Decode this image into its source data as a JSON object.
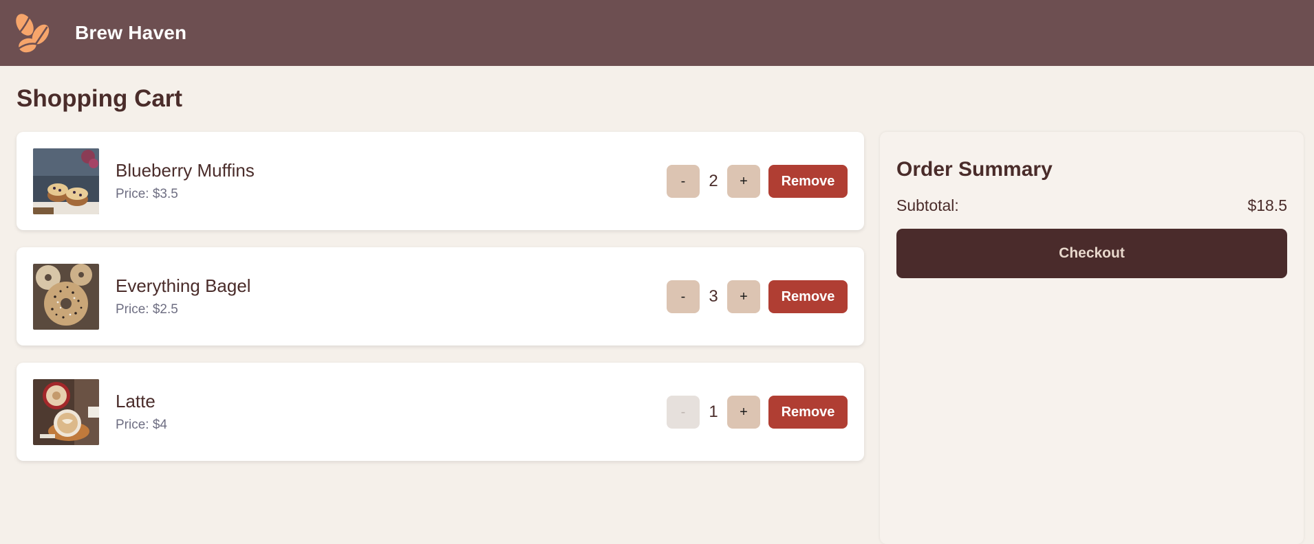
{
  "header": {
    "brand": "Brew Haven",
    "logo_icon": "coffee-beans-icon",
    "bar_color": "#6d4f51",
    "logo_color": "#f6a56b"
  },
  "page": {
    "title": "Shopping Cart"
  },
  "cart": {
    "items": [
      {
        "name": "Blueberry Muffins",
        "price_label": "Price: $3.5",
        "quantity": "2",
        "decrement_label": "-",
        "increment_label": "+",
        "remove_label": "Remove",
        "image_icon": "blueberry-muffin-image",
        "decrement_disabled": false
      },
      {
        "name": "Everything Bagel",
        "price_label": "Price: $2.5",
        "quantity": "3",
        "decrement_label": "-",
        "increment_label": "+",
        "remove_label": "Remove",
        "image_icon": "bagel-image",
        "decrement_disabled": false
      },
      {
        "name": "Latte",
        "price_label": "Price: $4",
        "quantity": "1",
        "decrement_label": "-",
        "increment_label": "+",
        "remove_label": "Remove",
        "image_icon": "latte-image",
        "decrement_disabled": true
      }
    ]
  },
  "summary": {
    "title": "Order Summary",
    "subtotal_label": "Subtotal:",
    "subtotal_value": "$18.5",
    "checkout_label": "Checkout"
  },
  "colors": {
    "accent_remove": "#b03e33",
    "qty_button": "#dcc4b2",
    "checkout": "#4a2b2b",
    "background": "#f5f0ea"
  }
}
